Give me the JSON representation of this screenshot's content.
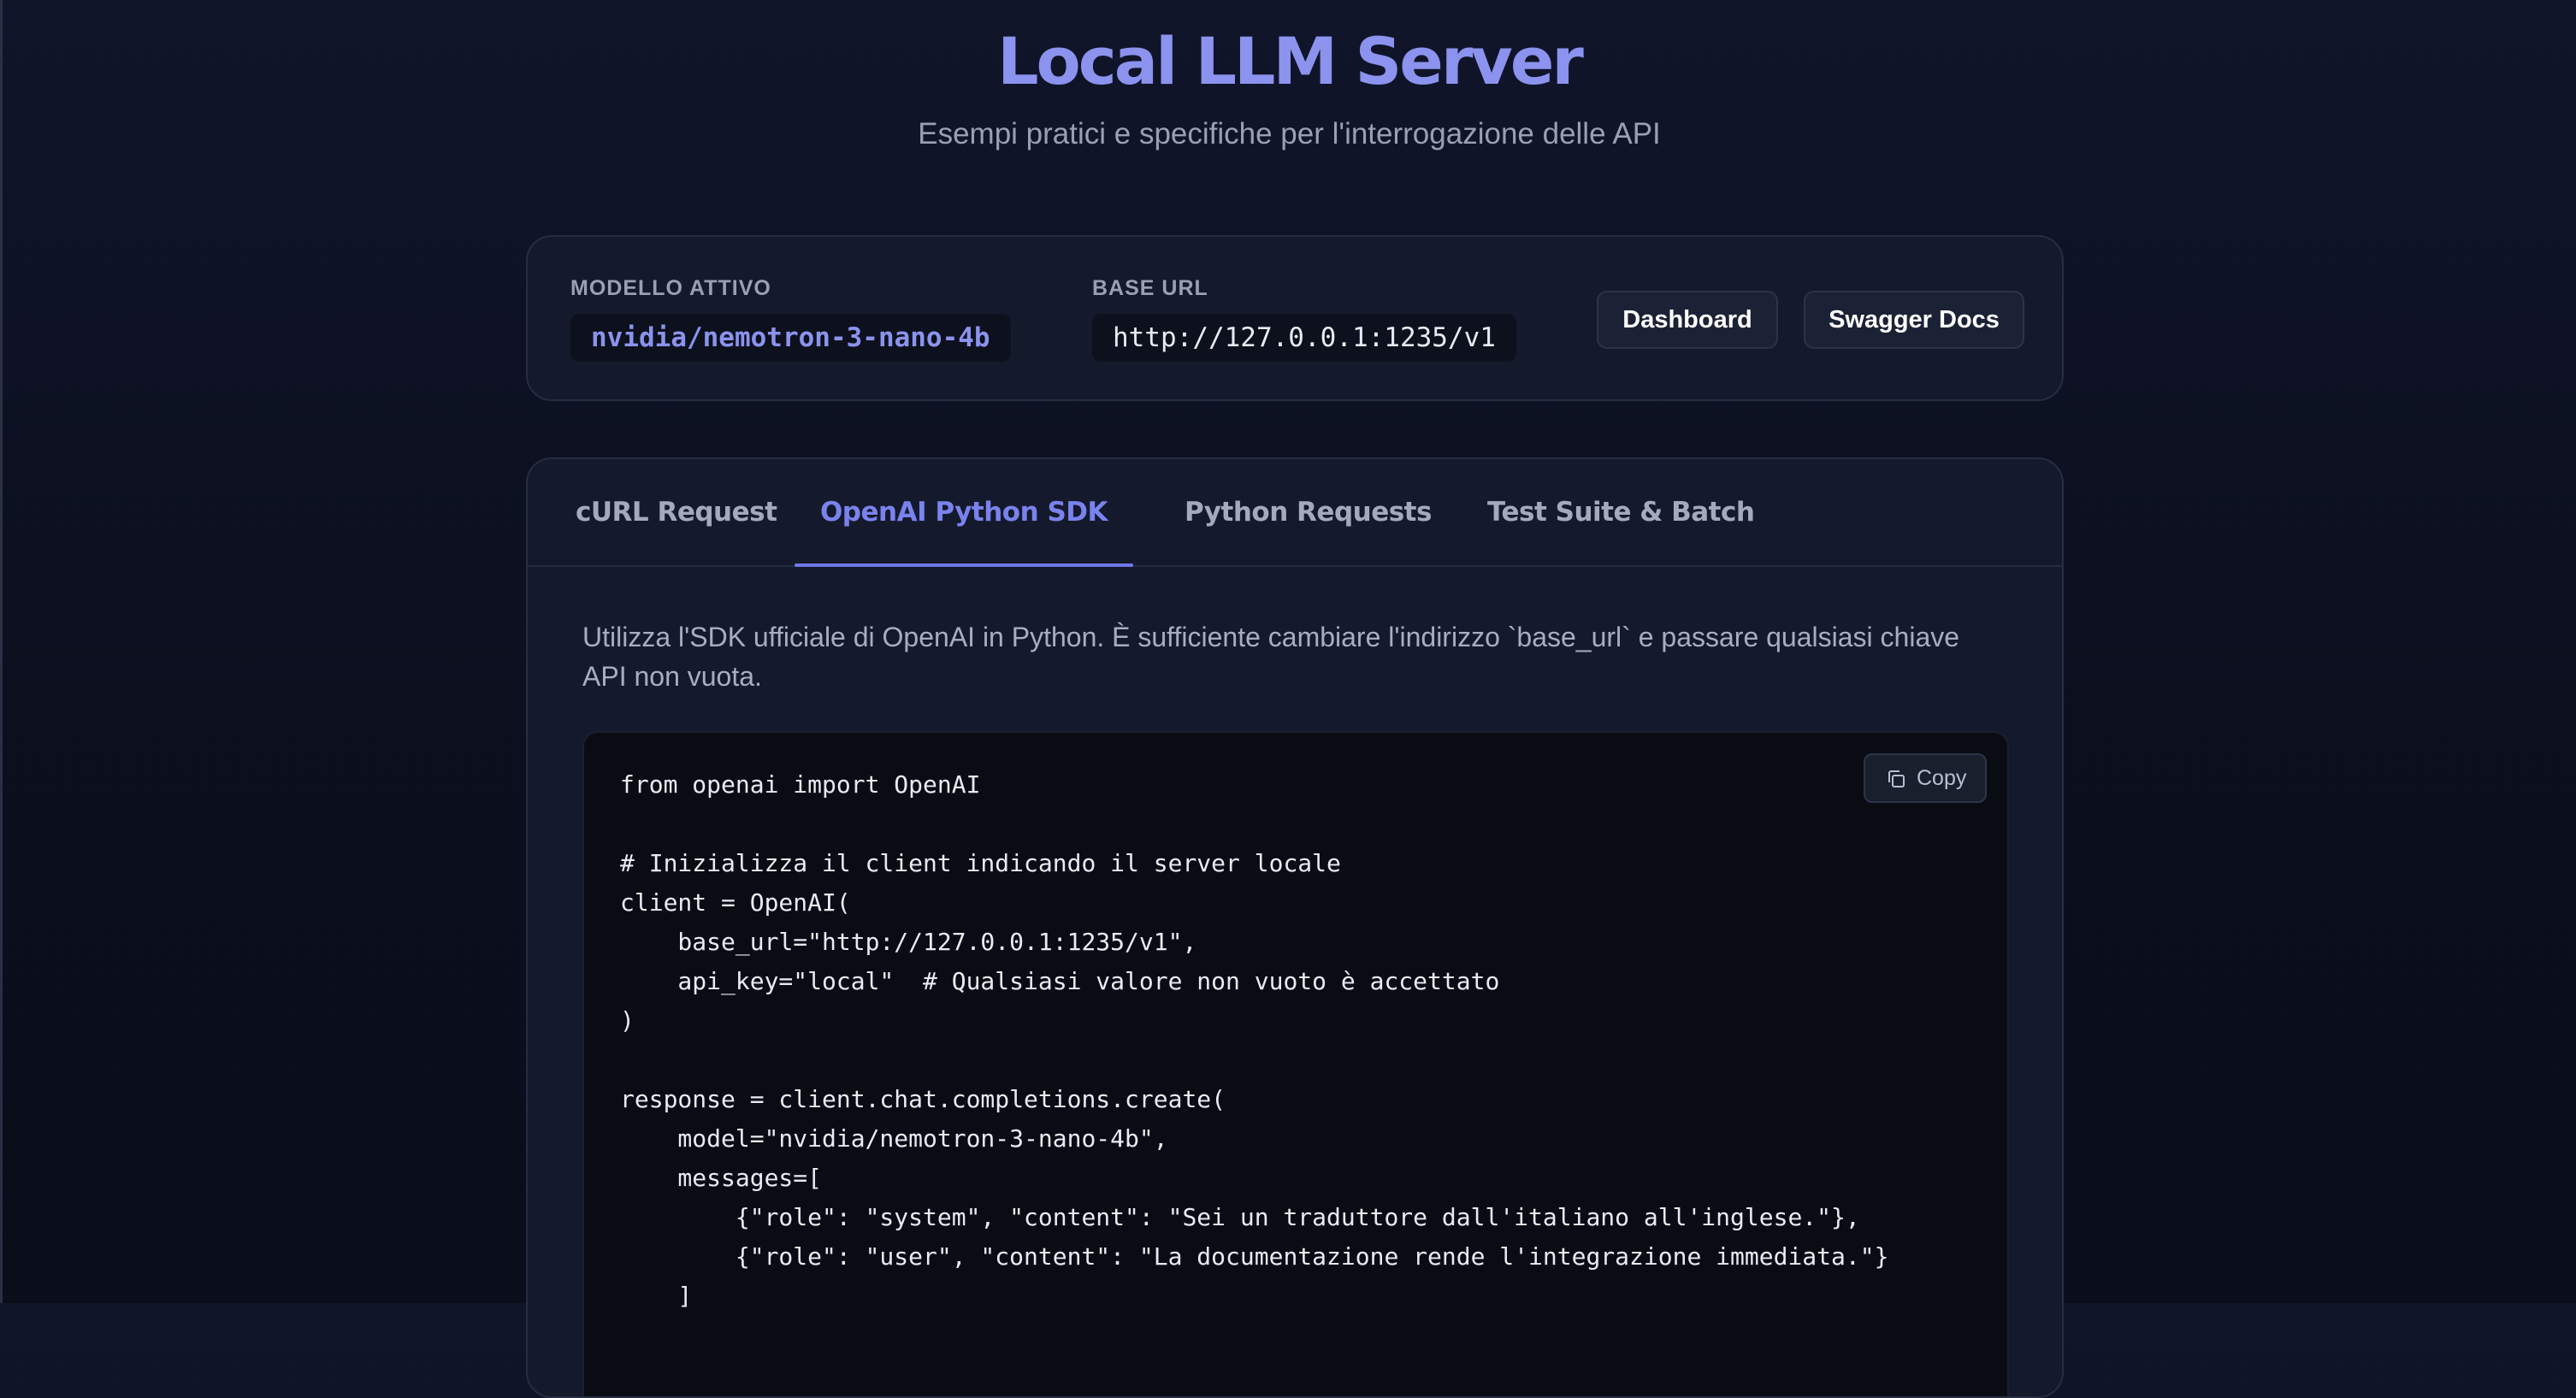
{
  "header": {
    "title": "Local LLM Server",
    "subtitle": "Esempi pratici e specifiche per l'interrogazione delle API"
  },
  "info": {
    "model_label": "MODELLO ATTIVO",
    "model_value": "nvidia/nemotron-3-nano-4b",
    "base_url_label": "BASE URL",
    "base_url_value": "http://127.0.0.1:1235/v1",
    "buttons": {
      "dashboard": "Dashboard",
      "swagger": "Swagger Docs"
    }
  },
  "tabs": [
    {
      "label": "cURL Request",
      "active": false
    },
    {
      "label": "OpenAI Python SDK",
      "active": true
    },
    {
      "label": "Python Requests",
      "active": false
    },
    {
      "label": "Test Suite & Batch",
      "active": false
    }
  ],
  "content": {
    "description": "Utilizza l'SDK ufficiale di OpenAI in Python. È sufficiente cambiare l'indirizzo `base_url` e passare qualsiasi chiave API non vuota.",
    "copy_label": "Copy",
    "copy_icon": "copy-icon",
    "code": "from openai import OpenAI\n\n# Inizializza il client indicando il server locale\nclient = OpenAI(\n    base_url=\"http://127.0.0.1:1235/v1\",\n    api_key=\"local\"  # Qualsiasi valore non vuoto è accettato\n)\n\nresponse = client.chat.completions.create(\n    model=\"nvidia/nemotron-3-nano-4b\",\n    messages=[\n        {\"role\": \"system\", \"content\": \"Sei un traduttore dall'italiano all'inglese.\"},\n        {\"role\": \"user\", \"content\": \"La documentazione rende l'integrazione immediata.\"}\n    ]"
  },
  "colors": {
    "accent": "#8b93ee",
    "tab_active": "#7a82ee",
    "background": "#0b0f1e",
    "card": "#141a2b",
    "code_bg": "#0a0c14"
  }
}
